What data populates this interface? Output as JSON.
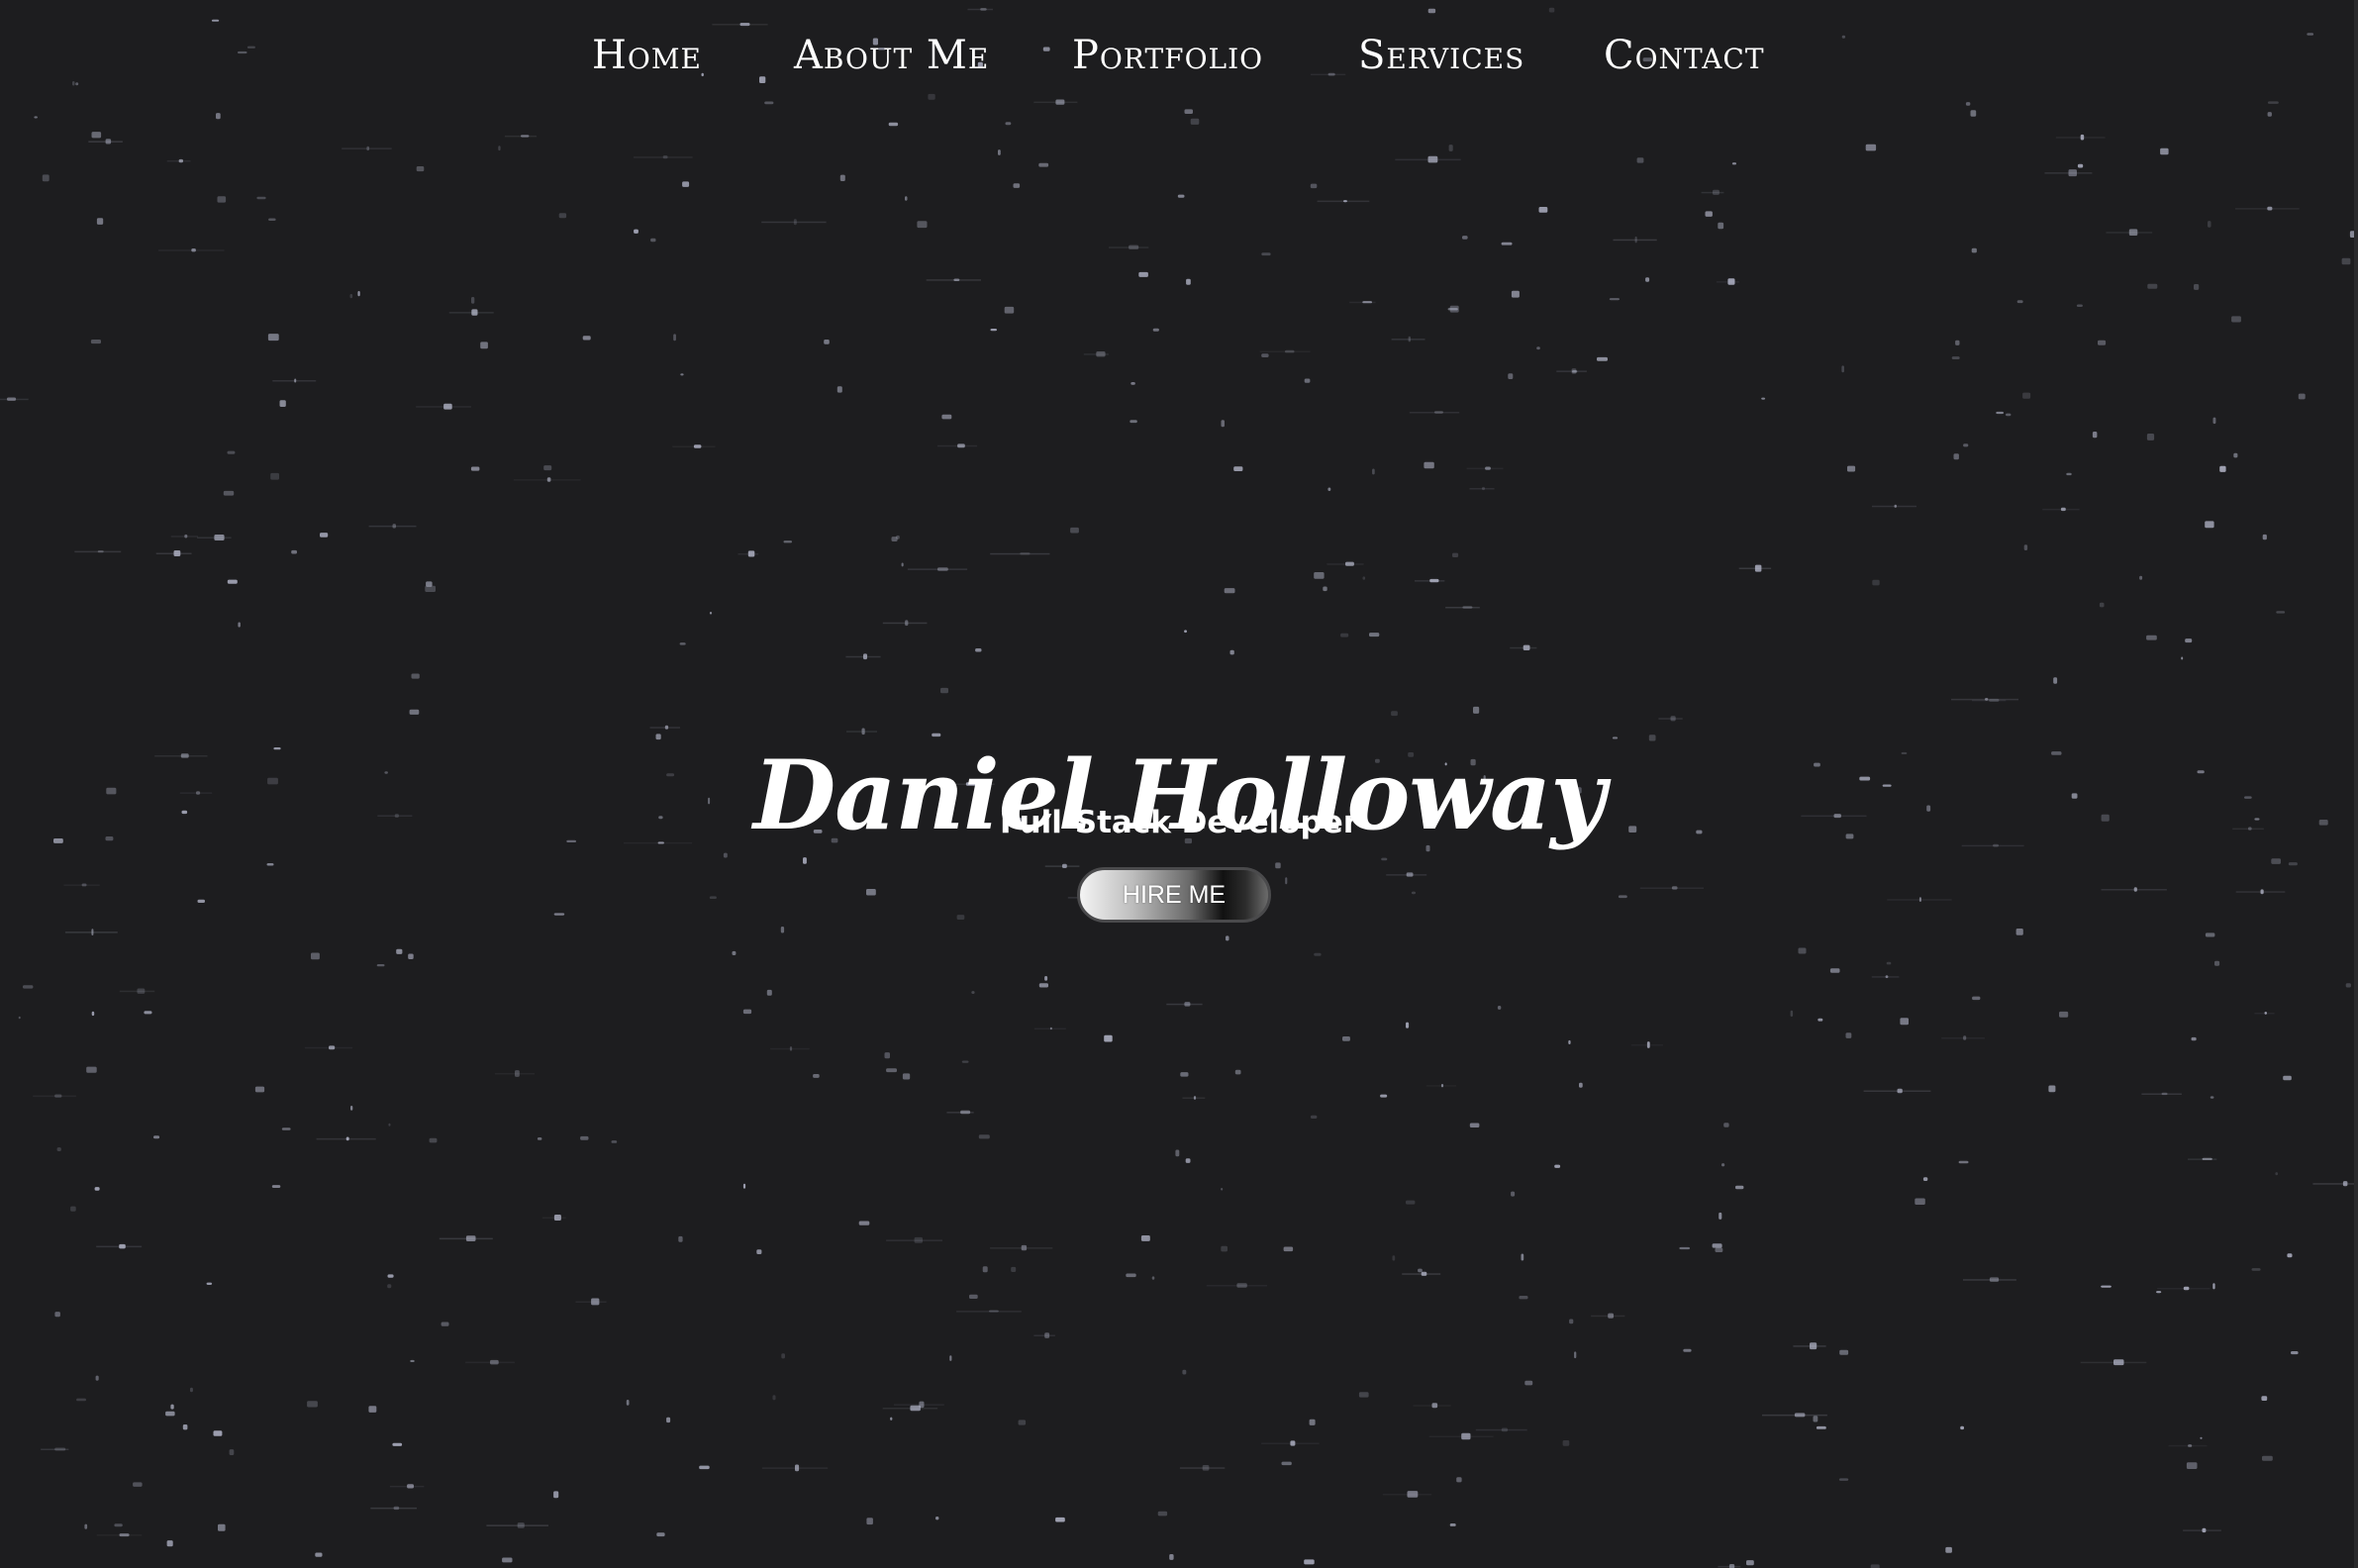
{
  "nav": {
    "items": [
      {
        "label": "Home"
      },
      {
        "label": "About Me"
      },
      {
        "label": "Portfolio"
      },
      {
        "label": "Services"
      },
      {
        "label": "Contact"
      }
    ]
  },
  "hero": {
    "name": "Daniel Holloway",
    "subtitle": "Full-Stack Developer",
    "cta_label": "HIRE ME"
  },
  "colors": {
    "background": "#1d1d1f",
    "text": "#ffffff",
    "star": "#c8cbe0"
  }
}
